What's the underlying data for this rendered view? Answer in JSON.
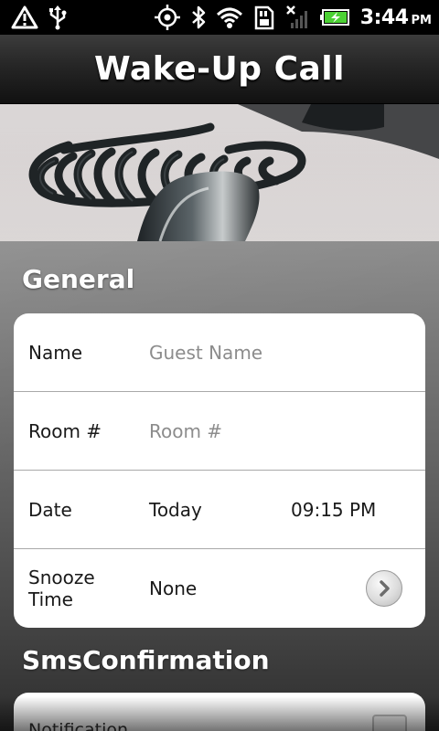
{
  "status_bar": {
    "icons": [
      "warning-icon",
      "usb-icon",
      "gps-icon",
      "bluetooth-icon",
      "wifi-icon",
      "sd-card-icon",
      "no-signal-icon",
      "battery-charging-icon"
    ],
    "time": "3:44",
    "ampm": "PM"
  },
  "header": {
    "title": "Wake-Up Call"
  },
  "banner": {
    "description_icon": "telephone-photo"
  },
  "sections": {
    "general": {
      "title": "General",
      "name": {
        "label": "Name",
        "placeholder": "Guest Name",
        "value": ""
      },
      "room": {
        "label": "Room #",
        "placeholder": "Room #",
        "value": ""
      },
      "date": {
        "label": "Date",
        "value": "Today",
        "time": "09:15 PM"
      },
      "snooze": {
        "label_line1": "Snooze",
        "label_line2": "Time",
        "value": "None"
      }
    },
    "sms": {
      "title": "SmsConfirmation",
      "notification": {
        "label": "Notification"
      }
    }
  },
  "colors": {
    "status_bar_bg": "#000000",
    "title_bar_bg": "#262626",
    "card_bg": "#ffffff",
    "placeholder_text": "#8c8c8c",
    "battery_accent": "#4cd134"
  }
}
